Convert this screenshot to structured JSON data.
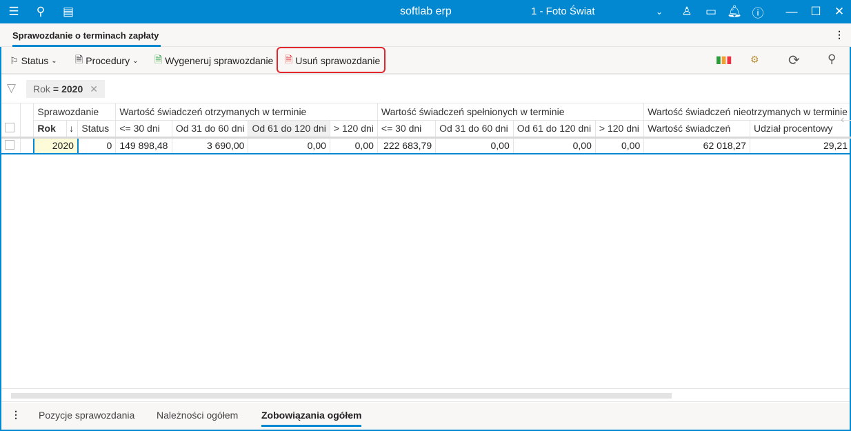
{
  "titlebar": {
    "app": "softlab erp",
    "company": "1 - Foto Świat"
  },
  "tab": {
    "label": "Sprawozdanie o terminach zapłaty"
  },
  "toolbar": {
    "status": "Status",
    "procedury": "Procedury",
    "generate": "Wygeneruj sprawozdanie",
    "delete": "Usuń sprawozdanie"
  },
  "filter": {
    "field": "Rok",
    "op": "=",
    "value": "2020"
  },
  "table": {
    "groups": [
      "Sprawozdanie",
      "Wartość świadczeń otrzymanych w terminie",
      "Wartość świadczeń spełnionych w terminie",
      "Wartość świadczeń nieotrzymanych w terminie"
    ],
    "columns": [
      "Rok",
      "Status",
      "<= 30 dni",
      "Od 31 do 60 dni",
      "Od 61 do 120 dni",
      "> 120 dni",
      "<= 30 dni",
      "Od 31 do 60 dni",
      "Od 61 do 120 dni",
      "> 120 dni",
      "Wartość świadczeń",
      "Udział procentowy"
    ],
    "row": [
      "2020",
      "0",
      "149 898,48",
      "3 690,00",
      "0,00",
      "0,00",
      "222 683,79",
      "0,00",
      "0,00",
      "0,00",
      "62 018,27",
      "29,21"
    ]
  },
  "bottom_tabs": [
    "Pozycje sprawozdania",
    "Należności ogółem",
    "Zobowiązania ogółem"
  ],
  "colors": {
    "accent": "#0288d1",
    "highlight": "#e3262b"
  }
}
